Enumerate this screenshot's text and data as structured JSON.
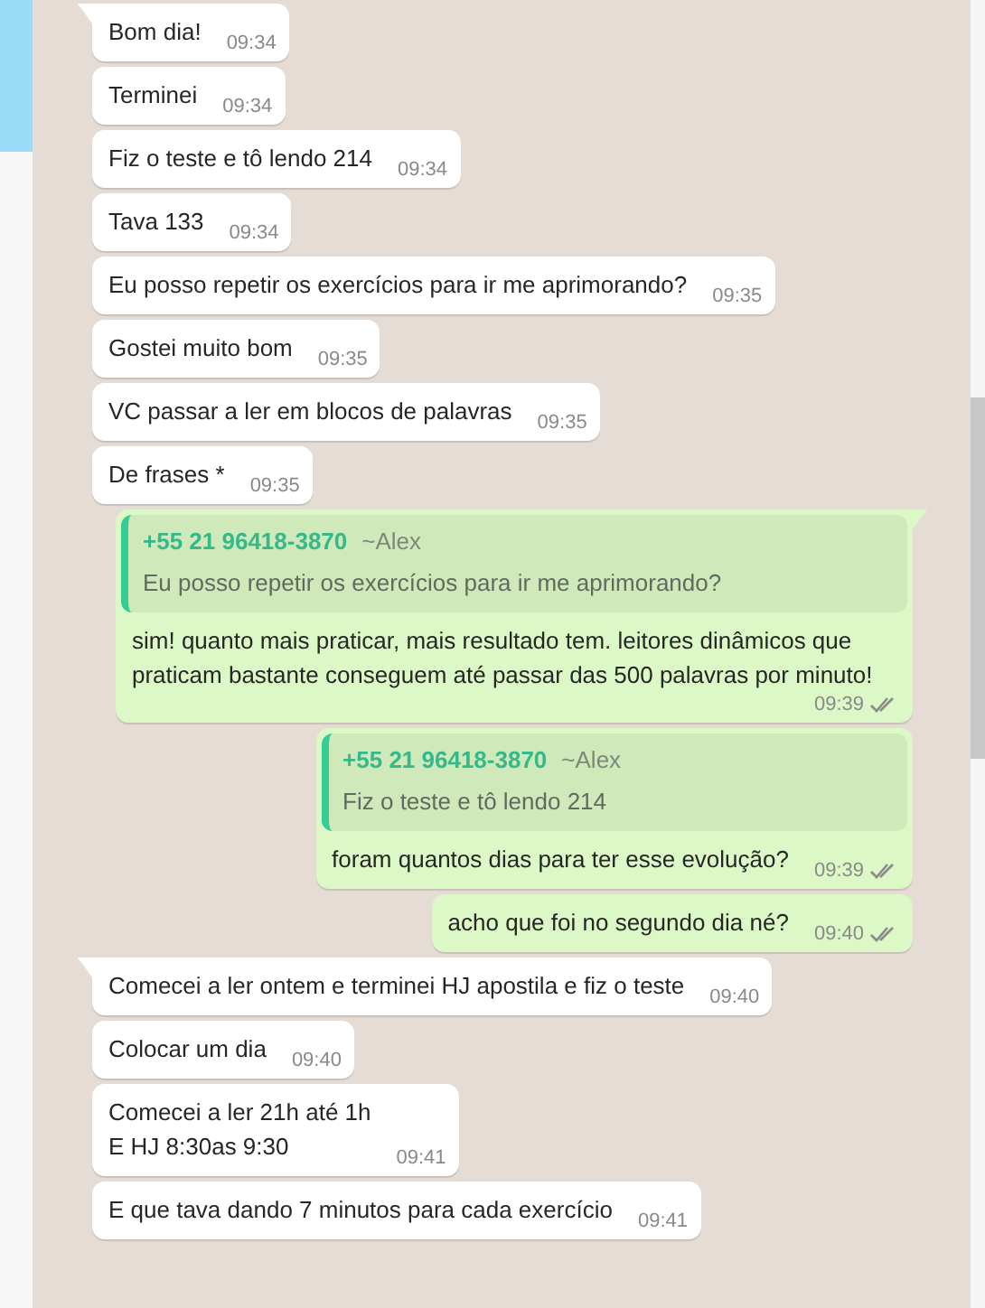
{
  "messages": [
    {
      "kind": "received",
      "tail": true,
      "text": "Bom dia!",
      "time": "09:34"
    },
    {
      "kind": "received",
      "tail": false,
      "text": "Terminei",
      "time": "09:34"
    },
    {
      "kind": "received",
      "tail": false,
      "text": "Fiz o teste e tô lendo 214",
      "time": "09:34"
    },
    {
      "kind": "received",
      "tail": false,
      "text": "Tava 133",
      "time": "09:34"
    },
    {
      "kind": "received",
      "tail": false,
      "text": "Eu posso repetir os exercícios para ir me aprimorando?",
      "time": "09:35"
    },
    {
      "kind": "received",
      "tail": false,
      "text": "Gostei muito bom",
      "time": "09:35"
    },
    {
      "kind": "received",
      "tail": false,
      "text": "VC passar a ler em blocos de palavras",
      "time": "09:35"
    },
    {
      "kind": "received",
      "tail": false,
      "text": "De frases *",
      "time": "09:35"
    },
    {
      "kind": "sent",
      "tail": true,
      "delivered": true,
      "quote": {
        "phone": "+55 21 96418-3870",
        "name": "~Alex",
        "text": "Eu posso repetir os exercícios para ir me aprimorando?"
      },
      "text": "sim! quanto mais praticar, mais resultado tem. leitores dinâmicos que praticam bastante conseguem até passar das 500 palavras por minuto!",
      "time": "09:39"
    },
    {
      "kind": "sent",
      "tail": false,
      "delivered": true,
      "quote": {
        "phone": "+55 21 96418-3870",
        "name": "~Alex",
        "text": "Fiz o teste e tô lendo 214"
      },
      "text": "foram quantos dias para ter esse evolução?",
      "time": "09:39"
    },
    {
      "kind": "sent",
      "tail": false,
      "delivered": true,
      "text": "acho que foi no segundo dia né?",
      "time": "09:40"
    },
    {
      "kind": "received",
      "tail": true,
      "text": "Comecei a ler ontem e terminei HJ apostila e fiz o teste",
      "time": "09:40"
    },
    {
      "kind": "received",
      "tail": false,
      "text": "Colocar um dia",
      "time": "09:40"
    },
    {
      "kind": "received",
      "tail": false,
      "text": "Comecei a ler 21h até 1h\nE HJ 8:30as 9:30",
      "time": "09:41"
    },
    {
      "kind": "received",
      "tail": false,
      "text": "E que tava dando 7 minutos para cada exercício",
      "time": "09:41"
    }
  ]
}
